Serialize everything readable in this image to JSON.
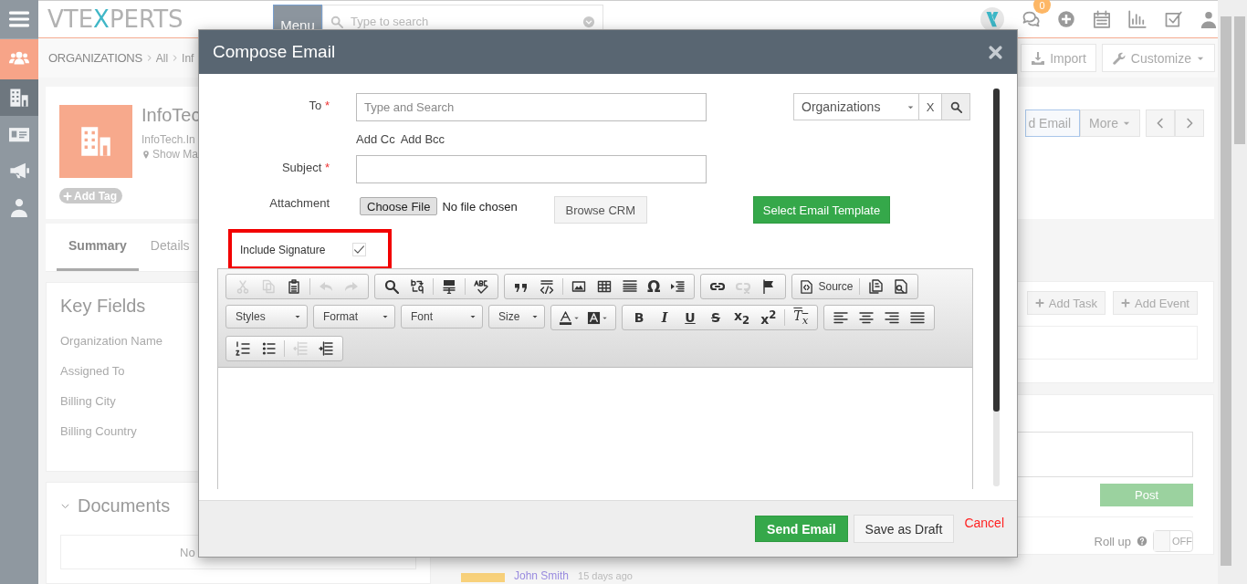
{
  "header": {
    "logo": [
      "VTE",
      "X",
      "PERTS"
    ],
    "menu_button": "Menu",
    "search": {
      "placeholder": "Type to search"
    },
    "notification_count": "0"
  },
  "sidebar": {
    "items": [
      {
        "kind": "module",
        "selected": false
      },
      {
        "kind": "link",
        "selected": true
      },
      {
        "kind": "link",
        "selected": false
      },
      {
        "kind": "link",
        "selected": false
      },
      {
        "kind": "link",
        "selected": false
      }
    ]
  },
  "breadcrumb": [
    "ORGANIZATIONS",
    "All",
    "Inf"
  ],
  "actions": [
    "Import",
    "Customize"
  ],
  "record": {
    "name": "InfoTec",
    "website": "InfoTech.In",
    "map_link": "Show Ma",
    "tag_button": "Add Tag",
    "buttons": [
      "d Email",
      "More"
    ]
  },
  "tabs": [
    {
      "label": "Summary",
      "selected": true
    },
    {
      "label": "Details",
      "selected": false
    }
  ],
  "key_fields": {
    "title": "Key Fields",
    "labels": [
      "Organization Name",
      "Assigned To",
      "Billing City",
      "Billing Country"
    ]
  },
  "documents": {
    "title": "Documents",
    "empty_text": "No"
  },
  "activities": {
    "buttons": [
      "Add Task",
      "Add Event"
    ]
  },
  "comments": {
    "post_button": "Post",
    "roll_up_label": "Roll up",
    "roll_up": {
      "on": false,
      "label": "OFF"
    }
  },
  "recent": {
    "author": "John Smith",
    "time": "15 days ago"
  },
  "compose": {
    "title": "Compose Email",
    "to": {
      "label": "To",
      "required_mark": "*",
      "placeholder": "Type and Search"
    },
    "module_select": {
      "value": "Organizations",
      "clear": "X"
    },
    "cc_links": [
      "Add Cc",
      "Add Bcc"
    ],
    "subject": {
      "label": "Subject",
      "required_mark": "*"
    },
    "attachment": {
      "label": "Attachment",
      "file_button": "Choose File",
      "file_status": "No file chosen",
      "browse_button": "Browse CRM"
    },
    "template_button": "Select Email Template",
    "include_signature": {
      "label": "Include Signature",
      "checked": true,
      "highlighted": true
    },
    "editor": {
      "toolbar": [
        [
          [
            [
              {
                "kind": "icon",
                "disabled": true
              },
              {
                "kind": "icon",
                "disabled": true
              },
              {
                "kind": "icon",
                "disabled": false
              }
            ],
            [
              {
                "kind": "icon",
                "disabled": true
              },
              {
                "kind": "icon",
                "disabled": true
              }
            ]
          ],
          [
            [
              {
                "kind": "icon",
                "disabled": false
              },
              {
                "kind": "icon",
                "disabled": false
              }
            ],
            [
              {
                "kind": "icon",
                "disabled": false
              }
            ],
            [
              {
                "kind": "icon",
                "disabled": false
              }
            ]
          ],
          [
            [
              {
                "kind": "icon",
                "disabled": false
              },
              {
                "kind": "icon",
                "disabled": false
              }
            ],
            [
              {
                "kind": "icon",
                "disabled": false
              },
              {
                "kind": "icon",
                "disabled": false
              },
              {
                "kind": "icon",
                "disabled": false
              },
              {
                "kind": "glyph",
                "label": "Ω",
                "disabled": false
              },
              {
                "kind": "icon",
                "disabled": false
              }
            ]
          ],
          [
            [
              {
                "kind": "icon",
                "disabled": false
              },
              {
                "kind": "icon",
                "disabled": true
              },
              {
                "kind": "icon",
                "disabled": false
              }
            ]
          ],
          [
            [
              {
                "kind": "icon-text",
                "label": "Source",
                "disabled": false
              }
            ],
            [
              {
                "kind": "icon",
                "disabled": false
              },
              {
                "kind": "icon",
                "disabled": false
              }
            ]
          ]
        ],
        [
          [
            [
              {
                "kind": "dropdown",
                "label": "Styles",
                "disabled": false
              }
            ]
          ],
          [
            [
              {
                "kind": "dropdown",
                "label": "Format",
                "disabled": false
              }
            ]
          ],
          [
            [
              {
                "kind": "dropdown",
                "label": "Font",
                "disabled": false
              }
            ]
          ],
          [
            [
              {
                "kind": "dropdown",
                "label": "Size",
                "disabled": false
              }
            ]
          ],
          [
            [
              {
                "kind": "color-menu",
                "disabled": false
              },
              {
                "kind": "color-menu",
                "disabled": false
              }
            ]
          ],
          [
            [
              {
                "kind": "format",
                "label": "B",
                "disabled": false
              },
              {
                "kind": "format",
                "label": "I",
                "disabled": false
              },
              {
                "kind": "format",
                "label": "U",
                "disabled": false
              },
              {
                "kind": "format",
                "label": "S",
                "disabled": false
              },
              {
                "kind": "format",
                "label": "x$_{2}$",
                "disabled": false
              },
              {
                "kind": "format",
                "label": "x$^{2}$",
                "disabled": false
              }
            ],
            [
              {
                "kind": "format",
                "label": "T$_{x}$",
                "disabled": false
              }
            ]
          ],
          [
            [
              {
                "kind": "icon",
                "disabled": false
              },
              {
                "kind": "icon",
                "disabled": false
              },
              {
                "kind": "icon",
                "disabled": false
              },
              {
                "kind": "icon",
                "disabled": false
              }
            ]
          ]
        ],
        [
          [
            [
              {
                "kind": "icon",
                "disabled": false
              },
              {
                "kind": "icon",
                "disabled": false
              }
            ],
            [
              {
                "kind": "icon",
                "disabled": true
              },
              {
                "kind": "icon",
                "disabled": false
              }
            ]
          ]
        ]
      ]
    },
    "footer": {
      "send": "Send Email",
      "draft": "Save as Draft",
      "cancel": "Cancel"
    }
  }
}
